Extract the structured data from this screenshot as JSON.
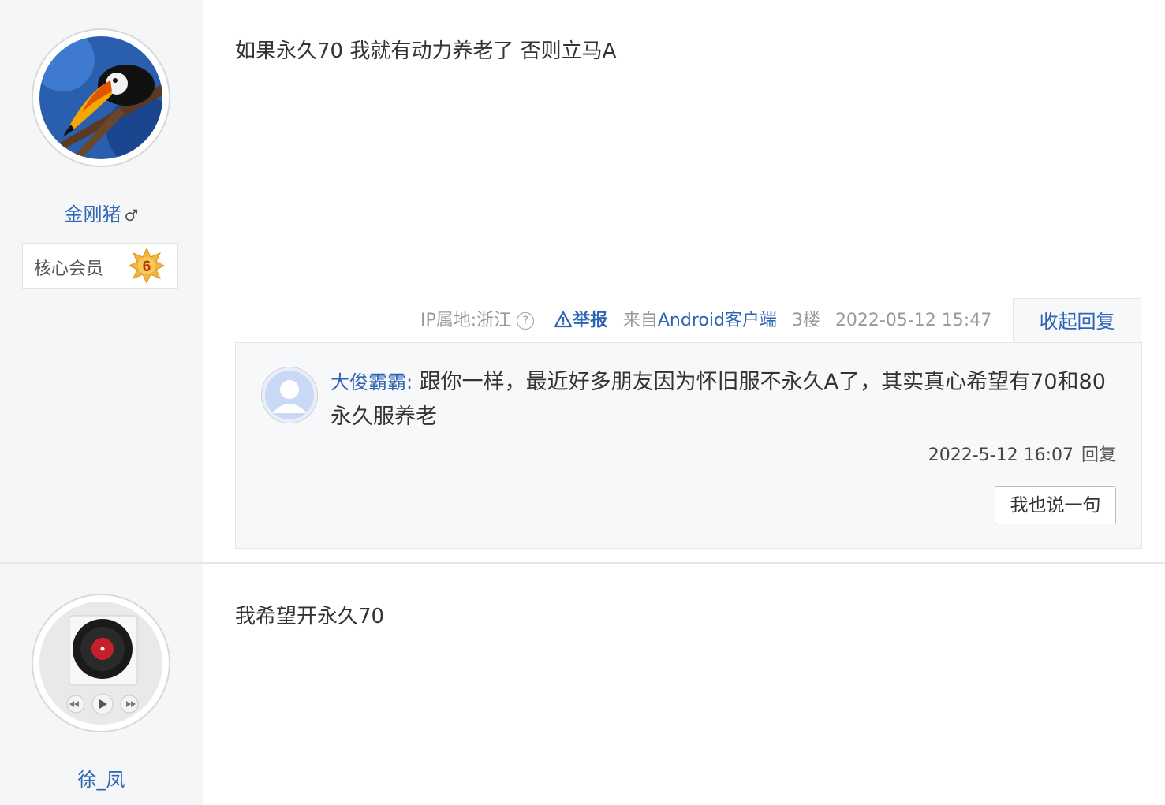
{
  "posts": [
    {
      "author": {
        "name": "金刚猪",
        "gender": "♂",
        "badge_label": "核心会员",
        "badge_level": "6"
      },
      "content": "如果永久70 我就有动力养老了 否则立马A",
      "meta": {
        "ip": "IP属地:浙江",
        "report": "举报",
        "source_prefix": "来自",
        "source": "Android客户端",
        "floor": "3楼",
        "datetime": "2022-05-12 15:47",
        "collapse": "收起回复"
      },
      "replies": [
        {
          "user": "大俊霸霸",
          "text": "跟你一样，最近好多朋友因为怀旧服不永久A了，其实真心希望有70和80永久服养老",
          "time": "2022-5-12 16:07",
          "reply_label": "回复"
        }
      ],
      "say_button": "我也说一句"
    },
    {
      "author": {
        "name": "徐_凤"
      },
      "content": "我希望开永久70"
    }
  ]
}
